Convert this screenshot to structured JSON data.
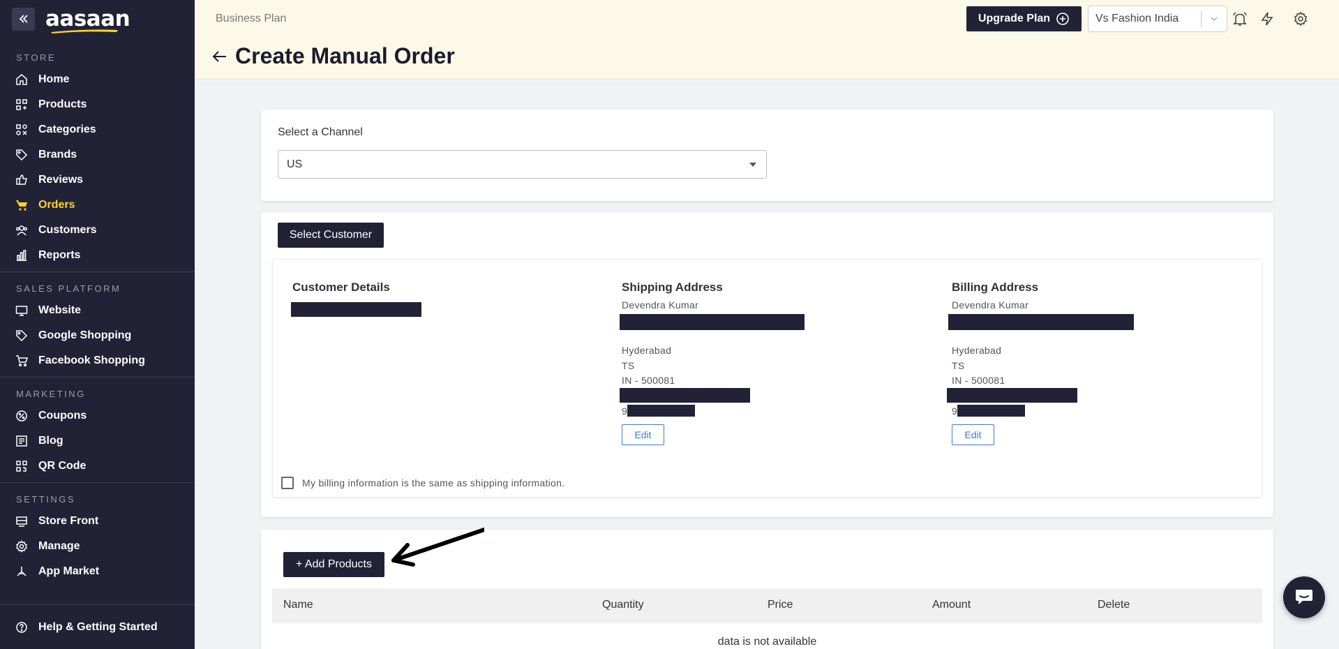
{
  "brand": {
    "logo_text": "aasaan"
  },
  "sidebar": {
    "sections": [
      {
        "title": "STORE",
        "items": [
          {
            "label": "Home",
            "icon": "home-icon"
          },
          {
            "label": "Products",
            "icon": "products-icon"
          },
          {
            "label": "Categories",
            "icon": "categories-icon"
          },
          {
            "label": "Brands",
            "icon": "tag-icon"
          },
          {
            "label": "Reviews",
            "icon": "reviews-icon"
          },
          {
            "label": "Orders",
            "icon": "cart-icon",
            "active": true
          },
          {
            "label": "Customers",
            "icon": "customers-icon"
          },
          {
            "label": "Reports",
            "icon": "reports-icon"
          }
        ]
      },
      {
        "title": "SALES PLATFORM",
        "items": [
          {
            "label": "Website",
            "icon": "monitor-icon"
          },
          {
            "label": "Google Shopping",
            "icon": "tag-icon"
          },
          {
            "label": "Facebook Shopping",
            "icon": "cart-icon"
          }
        ]
      },
      {
        "title": "MARKETING",
        "items": [
          {
            "label": "Coupons",
            "icon": "coupon-icon"
          },
          {
            "label": "Blog",
            "icon": "blog-icon"
          },
          {
            "label": "QR Code",
            "icon": "qr-icon"
          }
        ]
      },
      {
        "title": "SETTINGS",
        "items": [
          {
            "label": "Store Front",
            "icon": "storefront-icon"
          },
          {
            "label": "Manage",
            "icon": "gear-icon"
          },
          {
            "label": "App Market",
            "icon": "app-market-icon"
          }
        ]
      }
    ],
    "help_label": "Help & Getting Started"
  },
  "header": {
    "plan_label": "Business Plan",
    "page_title": "Create Manual Order",
    "upgrade_label": "Upgrade Plan",
    "store_selected": "Vs Fashion India"
  },
  "channel": {
    "label": "Select a Channel",
    "selected": "US"
  },
  "customer": {
    "select_button": "Select Customer",
    "details_heading": "Customer Details",
    "shipping": {
      "heading": "Shipping Address",
      "name": "Devendra Kumar",
      "city": "Hyderabad",
      "state": "TS",
      "country_zip": "IN - 500081",
      "phone_prefix": "9",
      "edit_label": "Edit"
    },
    "billing": {
      "heading": "Billing Address",
      "name": "Devendra Kumar",
      "city": "Hyderabad",
      "state": "TS",
      "country_zip": "IN - 500081",
      "phone_prefix": "9",
      "edit_label": "Edit"
    },
    "same_as_shipping_label": "My billing information is the same as shipping information.",
    "same_as_shipping_checked": false
  },
  "products": {
    "add_button": "+ Add Products",
    "columns": [
      "Name",
      "Quantity",
      "Price",
      "Amount",
      "Delete"
    ],
    "empty_message": "data is not available"
  },
  "colors": {
    "sidebar_bg": "#222236",
    "active_accent": "#ffd32a",
    "header_bg": "#fdf9e8",
    "edit_blue": "#3d7bd1"
  }
}
